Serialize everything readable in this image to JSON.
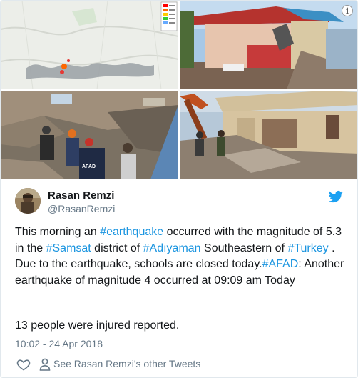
{
  "media": {
    "photos": [
      {
        "label": "map"
      },
      {
        "label": "damaged-house"
      },
      {
        "label": "rescue-workers"
      },
      {
        "label": "collapsed-building"
      }
    ],
    "afad_label": "AFAD"
  },
  "author": {
    "name": "Rasan Remzi",
    "handle": "@RasanRemzi"
  },
  "tweet": {
    "text_segments": [
      {
        "text": "This morning an ",
        "tag": false
      },
      {
        "text": "#earthquake",
        "tag": true
      },
      {
        "text": " occurred with the magnitude of 5.3 in the ",
        "tag": false
      },
      {
        "text": "#Samsat",
        "tag": true
      },
      {
        "text": " district of ",
        "tag": false
      },
      {
        "text": "#Adıyaman",
        "tag": true
      },
      {
        "text": " Southeastern of ",
        "tag": false
      },
      {
        "text": "#Turkey",
        "tag": true
      },
      {
        "text": " . Due to the earthquake, schools are closed today.",
        "tag": false
      },
      {
        "text": "#AFAD",
        "tag": true
      },
      {
        "text": ": Another earthquake of magnitude 4 occurred at 09:09 am Today",
        "tag": false
      }
    ],
    "second_paragraph": "13 people were injured reported.",
    "timestamp": "10:02 - 24 Apr 2018"
  },
  "actions": {
    "other_tweets_label": "See Rasan Remzi's other Tweets"
  },
  "colors": {
    "hashtag": "#1b95e0",
    "twitter_blue": "#1da1f2",
    "secondary_text": "#657786"
  },
  "icons": [
    "info-icon",
    "twitter-bird-icon",
    "heart-icon",
    "person-icon"
  ]
}
